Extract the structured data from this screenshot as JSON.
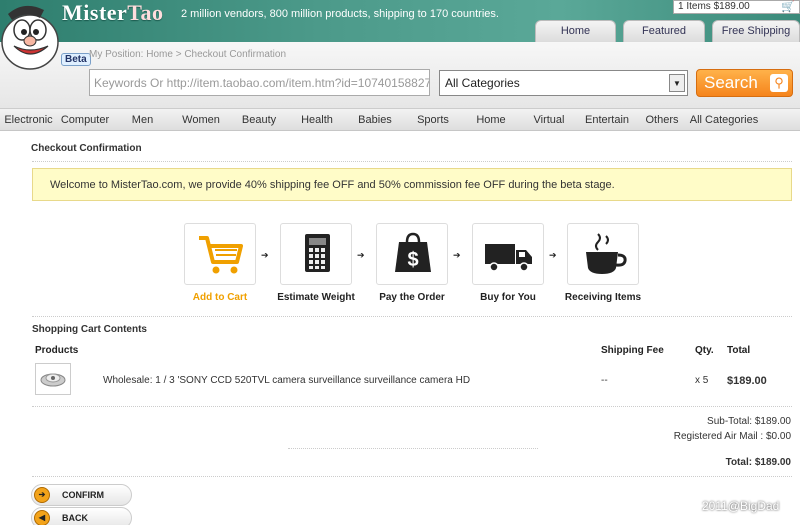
{
  "brand": {
    "part1": "Mister",
    "part2": "Tao",
    "tagline": "2 million vendors, 800 million products, shipping to 170 countries.",
    "beta": "Beta"
  },
  "minicart": {
    "text": "1 Items $189.00"
  },
  "nav": [
    {
      "label": "Home"
    },
    {
      "label": "Featured"
    },
    {
      "label": "Free Shipping"
    }
  ],
  "breadcrumb": "My Position: Home > Checkout Confirmation",
  "search": {
    "value": "Keywords Or http://item.taobao.com/item.htm?id=10740158827",
    "category": "All Categories",
    "button": "Search"
  },
  "categories": [
    "Electronic",
    "Computer",
    "Men",
    "Women",
    "Beauty",
    "Health",
    "Babies",
    "Sports",
    "Home",
    "Virtual",
    "Entertain",
    "Others",
    "All Categories"
  ],
  "page": {
    "title": "Checkout Confirmation",
    "welcome": "Welcome to MisterTao.com, we provide 40% shipping fee OFF and 50% commission fee OFF during the beta stage."
  },
  "steps": [
    {
      "label": "Add to Cart",
      "icon": "cart-icon",
      "active": true
    },
    {
      "label": "Estimate Weight",
      "icon": "calculator-icon",
      "active": false
    },
    {
      "label": "Pay the Order",
      "icon": "shopping-bag-dollar-icon",
      "active": false
    },
    {
      "label": "Buy for You",
      "icon": "truck-icon",
      "active": false
    },
    {
      "label": "Receiving Items",
      "icon": "coffee-cup-icon",
      "active": false
    }
  ],
  "cart": {
    "title": "Shopping Cart Contents",
    "headers": {
      "products": "Products",
      "shipping": "Shipping Fee",
      "qty": "Qty.",
      "total": "Total"
    },
    "items": [
      {
        "name": "Wholesale: 1 / 3 'SONY CCD 520TVL camera surveillance surveillance camera HD",
        "shipping": "--",
        "qty": "x 5",
        "total": "$189.00"
      }
    ],
    "subtotal": "Sub-Total: $189.00",
    "airmail": "Registered Air Mail : $0.00",
    "total_label": "Total:",
    "total_value": "$189.00"
  },
  "buttons": {
    "confirm": "CONFIRM",
    "back": "BACK"
  },
  "watermark": "2011@BigDad"
}
